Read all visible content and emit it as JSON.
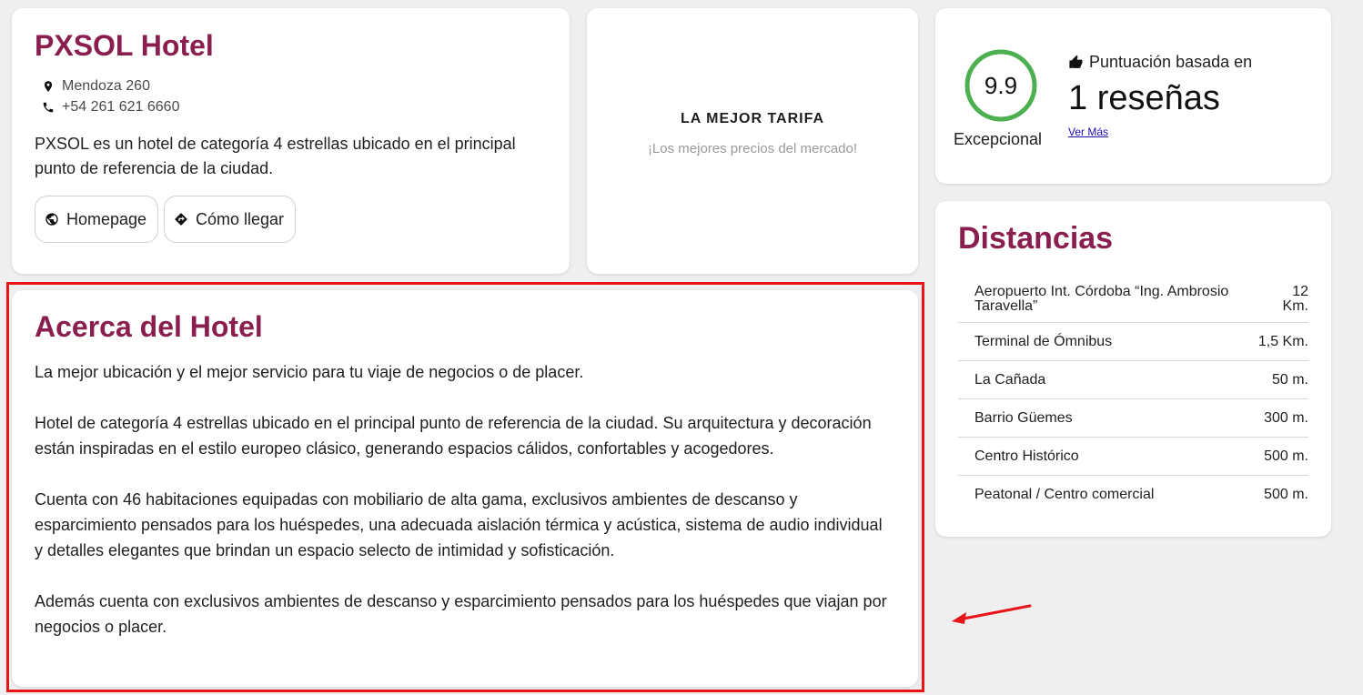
{
  "hotel": {
    "name": "PXSOL Hotel",
    "address": "Mendoza 260",
    "phone": "+54 261 621 6660",
    "description": "PXSOL es un hotel de categoría 4 estrellas ubicado en el principal punto de referencia de la ciudad.",
    "homepage_label": "Homepage",
    "directions_label": "Cómo llegar",
    "icons": {
      "address": "map-pin-icon",
      "phone": "phone-icon",
      "homepage": "globe-icon",
      "directions": "directions-icon"
    }
  },
  "best_rate": {
    "title": "LA MEJOR TARIFA",
    "subtitle": "¡Los mejores precios del mercado!"
  },
  "score": {
    "value": "9.9",
    "label": "Excepcional",
    "basis_label": "Puntuación basada en",
    "reviews": "1 reseñas",
    "see_more": "Ver Más",
    "ring_color": "#4caf50",
    "ring_fraction": 0.99,
    "icon": "thumbs-up-icon"
  },
  "distances": {
    "title": "Distancias",
    "items": [
      {
        "name": "Aeropuerto Int. Córdoba “Ing. Ambrosio Taravella”",
        "value": "12 Km."
      },
      {
        "name": "Terminal de Ómnibus",
        "value": "1,5 Km."
      },
      {
        "name": "La Cañada",
        "value": "50 m."
      },
      {
        "name": "Barrio Güemes",
        "value": "300 m."
      },
      {
        "name": "Centro Histórico",
        "value": "500 m."
      },
      {
        "name": "Peatonal / Centro comercial",
        "value": "500 m."
      }
    ]
  },
  "about": {
    "title": "Acerca del Hotel",
    "paragraphs": [
      "La mejor ubicación y el mejor servicio para tu viaje de negocios o de placer.",
      "Hotel de categoría 4 estrellas ubicado en el principal punto de referencia de la ciudad. Su arquitectura y decoración están inspiradas en el estilo europeo clásico, generando espacios cálidos, confortables y acogedores.",
      "Cuenta con 46 habitaciones equipadas con mobiliario de alta gama, exclusivos ambientes de descanso y esparcimiento pensados para los huéspedes, una adecuada aislación térmica y acústica, sistema de audio individual y detalles elegantes que brindan un espacio selecto de intimidad y sofisticación.",
      "Además cuenta con exclusivos ambientes de descanso y esparcimiento pensados para los huéspedes que viajan por negocios o placer."
    ]
  },
  "colors": {
    "brand": "#8a1e4e",
    "highlight": "#e8141a",
    "link": "#1a0dab"
  }
}
